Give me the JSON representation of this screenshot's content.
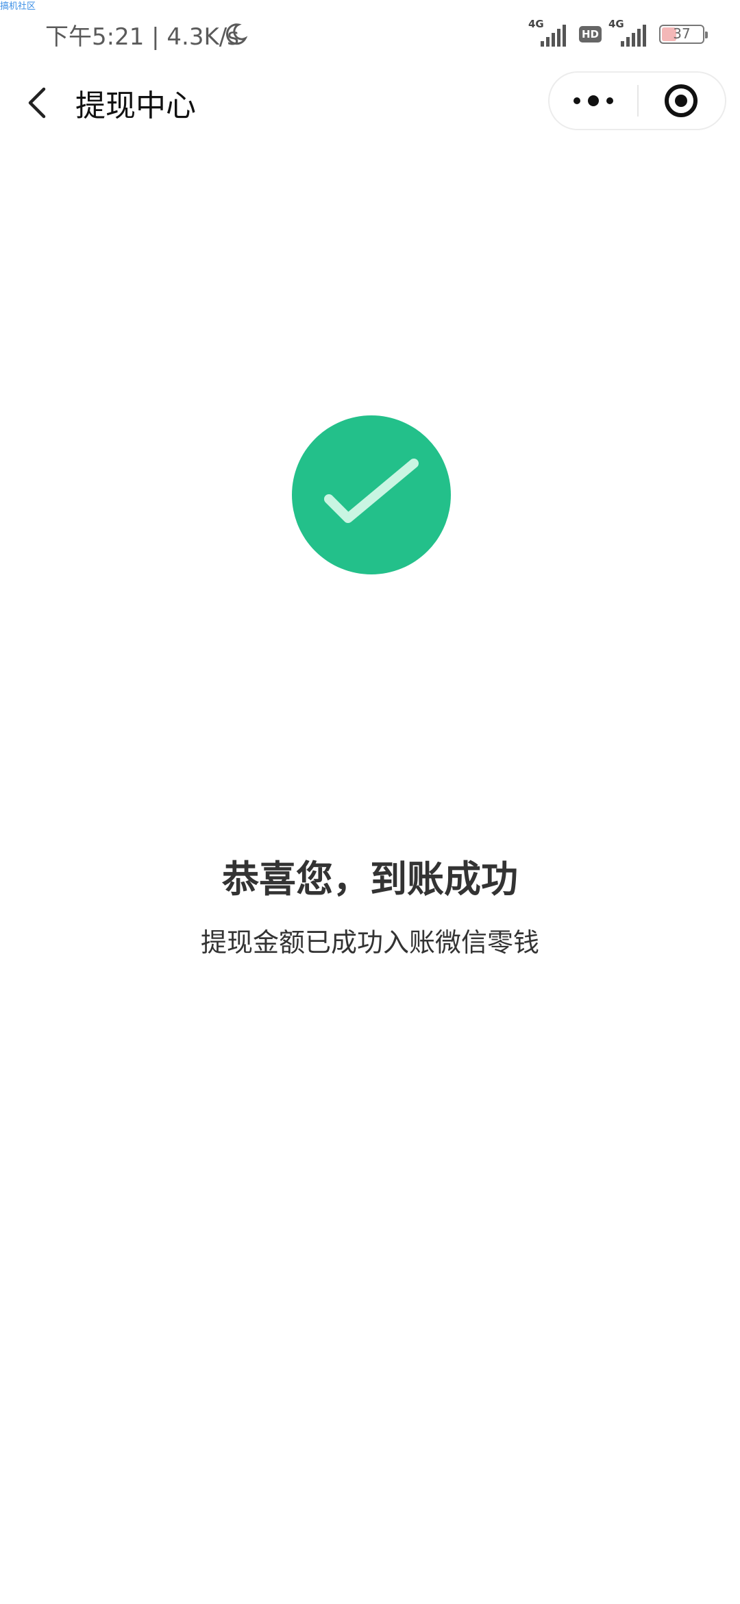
{
  "watermark": "搞机社区",
  "status_bar": {
    "time_speed": "下午5:21 | 4.3K/s",
    "network_1": "4G",
    "hd": "HD",
    "network_2": "4G",
    "battery_level": "37",
    "battery_fraction": 0.37
  },
  "header": {
    "title": "提现中心"
  },
  "result": {
    "title": "恭喜您，到账成功",
    "subtitle": "提现金额已成功入账微信零钱"
  },
  "colors": {
    "success_green": "#23c08a",
    "check_light": "#c9f5e2"
  },
  "icons": {
    "moon": "moon-icon",
    "back": "back-arrow-icon",
    "more": "more-dots-icon",
    "close": "close-target-icon",
    "success": "checkmark-circle-icon"
  }
}
